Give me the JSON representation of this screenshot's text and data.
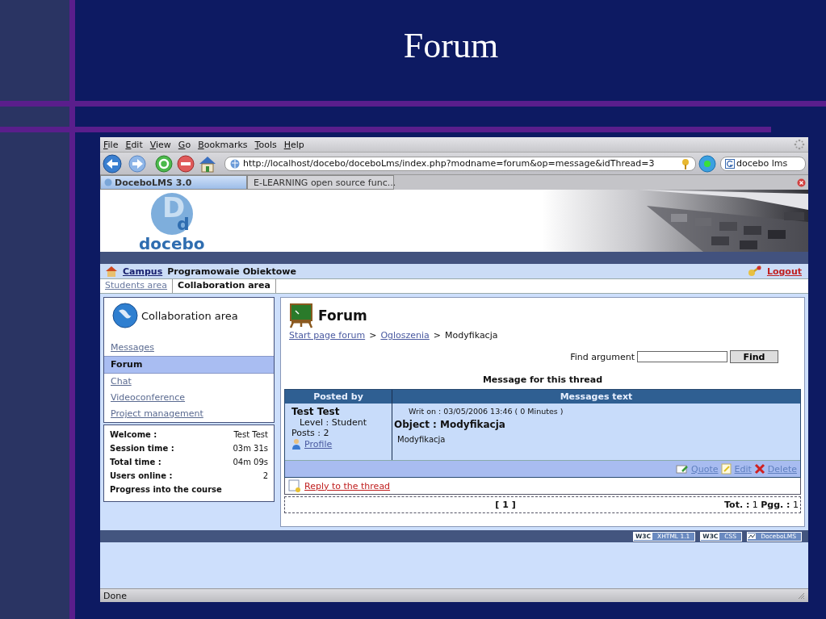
{
  "slide": {
    "title": "Forum"
  },
  "browser": {
    "menu": [
      "File",
      "Edit",
      "View",
      "Go",
      "Bookmarks",
      "Tools",
      "Help"
    ],
    "url": "http://localhost/docebo/doceboLms/index.php?modname=forum&op=message&idThread=3",
    "search_value": "docebo lms",
    "tabs": [
      {
        "label": "DoceboLMS 3.0",
        "selected": true
      },
      {
        "label": "E-LEARNING open source func...",
        "selected": false
      }
    ],
    "status": "Done"
  },
  "site": {
    "logo_initials": [
      "D",
      "d"
    ],
    "logo_text": "docebo",
    "nav": {
      "campus": "Campus",
      "course": "Programowaie Obiektowe",
      "logout": "Logout"
    },
    "area_tabs": [
      {
        "label": "Students area",
        "selected": false
      },
      {
        "label": "Collaboration area",
        "selected": true
      }
    ],
    "footer_badges": [
      {
        "mark": "W3C",
        "label": "XHTML 1.1"
      },
      {
        "mark": "W3C",
        "label": "CSS"
      },
      {
        "label": "DoceboLMS"
      }
    ]
  },
  "sidebar": {
    "title": "Collaboration area",
    "items": [
      {
        "label": "Messages",
        "selected": false
      },
      {
        "label": "Forum",
        "selected": true
      },
      {
        "label": "Chat",
        "selected": false
      },
      {
        "label": "Videoconference",
        "selected": false
      },
      {
        "label": "Project management",
        "selected": false
      }
    ],
    "stats": [
      {
        "label": "Welcome :",
        "value": "Test Test"
      },
      {
        "label": "Session time :",
        "value": "03m 31s"
      },
      {
        "label": "Total time :",
        "value": "04m 09s"
      },
      {
        "label": "Users online :",
        "value": "2"
      },
      {
        "label": "Progress into the course"
      }
    ]
  },
  "forum": {
    "title": "Forum",
    "crumbs": [
      {
        "label": "Start page forum",
        "kind": "link"
      },
      {
        "label": ">",
        "kind": "separator"
      },
      {
        "label": "Ogloszenia",
        "kind": "link"
      },
      {
        "label": ">",
        "kind": "separator"
      },
      {
        "label": "Modyfikacja",
        "kind": "current"
      }
    ],
    "find_label": "Find argument",
    "find_button": "Find",
    "caption": "Message for this thread",
    "columns": [
      "Posted by",
      "Messages text"
    ],
    "post": {
      "author": "Test Test",
      "level": "Level : Student",
      "posts": "Posts : 2",
      "profile": "Profile",
      "date": "Writ on : 03/05/2006 13:46 ( 0 Minutes )",
      "object": "Object : Modyfikacja",
      "body": "Modyfikacja"
    },
    "actions": [
      {
        "label": "Quote",
        "kind": "quote"
      },
      {
        "label": "Edit",
        "kind": "edit"
      },
      {
        "label": "Delete",
        "kind": "delete"
      }
    ],
    "reply": "Reply to the thread",
    "pager": "[ 1 ]",
    "total": "**Tot. :** 1 **Pgg. :** 1"
  }
}
